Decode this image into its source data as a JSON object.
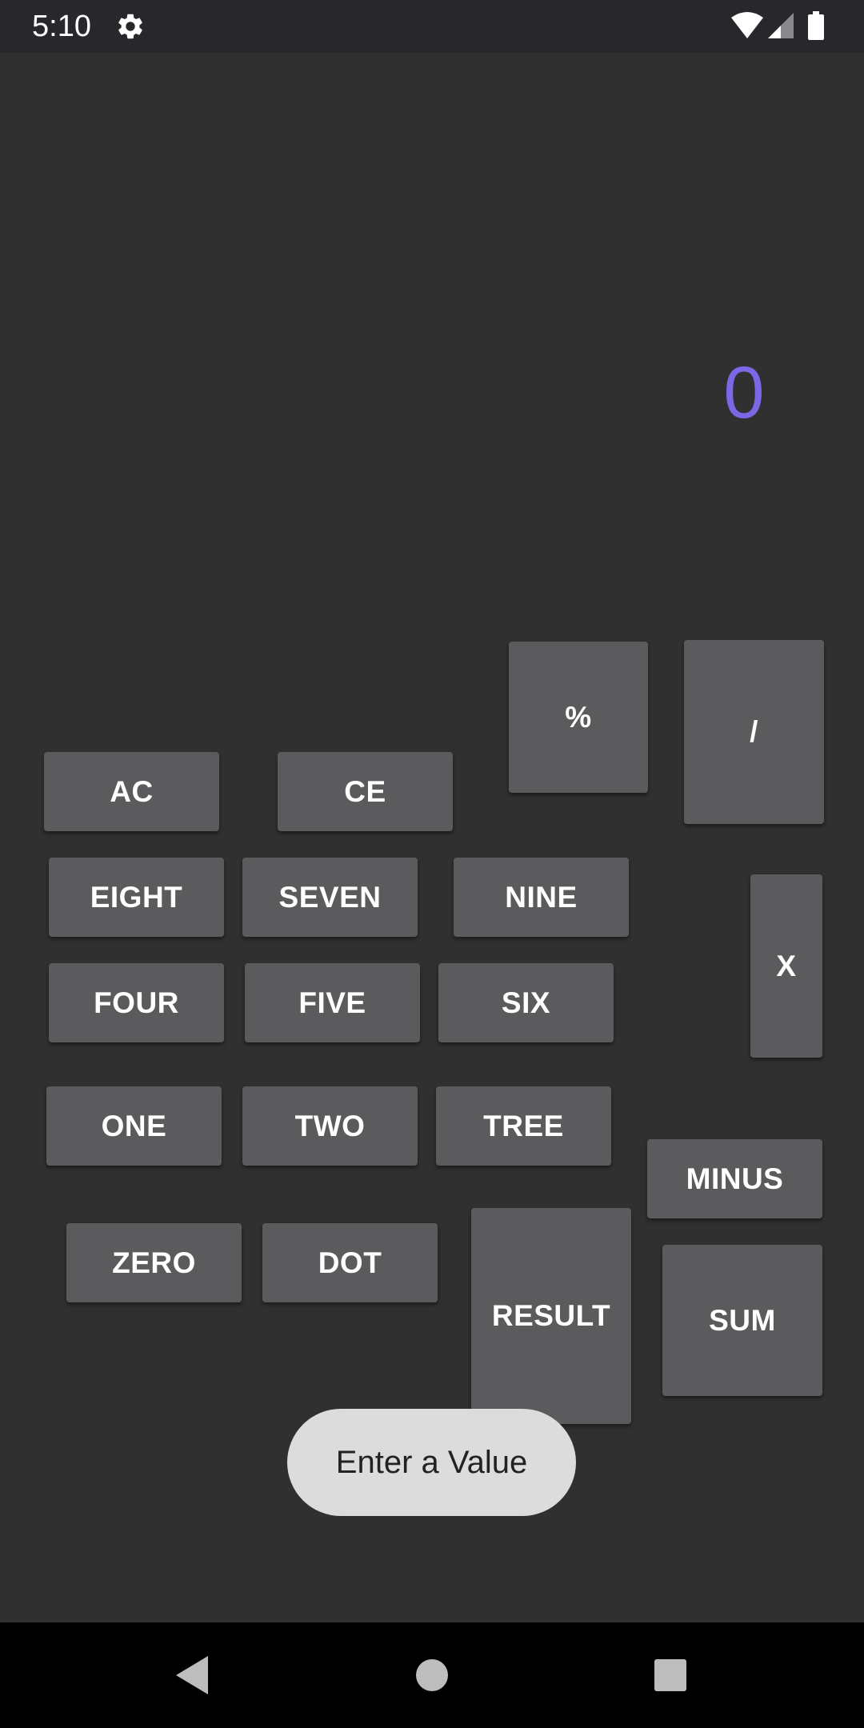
{
  "status_bar": {
    "time": "5:10",
    "icons": [
      "gear-icon",
      "wifi-icon",
      "cell-signal-icon",
      "battery-icon"
    ]
  },
  "display": {
    "value": "0",
    "color": "#7b68e6"
  },
  "keys": {
    "percent": "%",
    "divide": "/",
    "ac": "AC",
    "ce": "CE",
    "eight": "EIGHT",
    "seven": "SEVEN",
    "nine": "NINE",
    "multiply": "X",
    "four": "FOUR",
    "five": "FIVE",
    "six": "SIX",
    "one": "ONE",
    "two": "TWO",
    "three": "TREE",
    "minus": "MINUS",
    "zero": "ZERO",
    "dot": "DOT",
    "result": "RESULT",
    "sum": "SUM"
  },
  "enter_button": {
    "label": "Enter a Value"
  },
  "nav_bar": {
    "icons": [
      "back-icon",
      "home-icon",
      "recents-icon"
    ]
  },
  "colors": {
    "background": "#303030",
    "key": "#5b5b5d",
    "accent": "#7b68e6",
    "pill": "#dcdcdc"
  }
}
